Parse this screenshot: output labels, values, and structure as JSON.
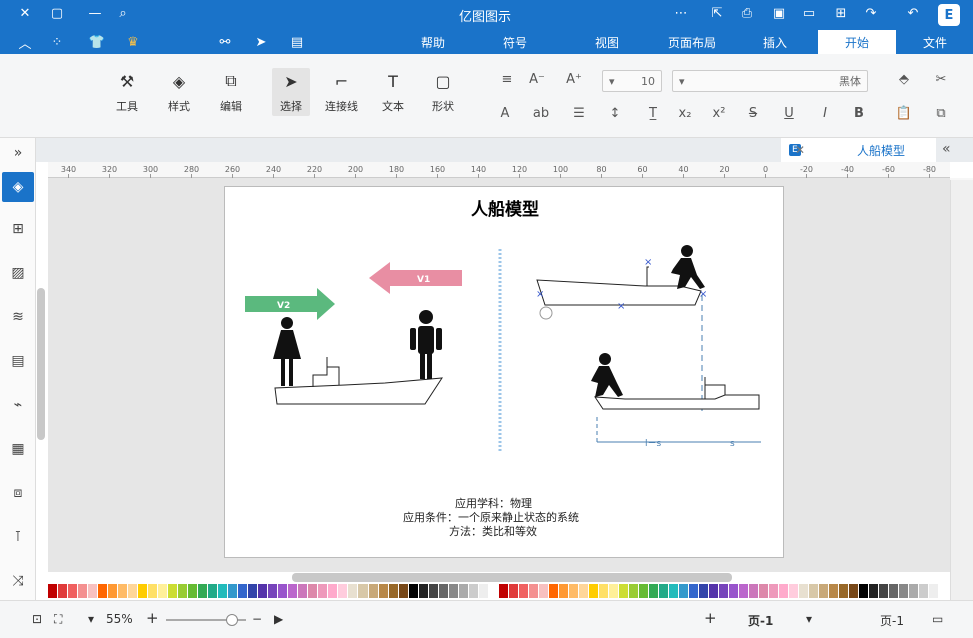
{
  "window": {
    "title": "亿图图示"
  },
  "tabs": [
    {
      "label": "文件"
    },
    {
      "label": "开始"
    },
    {
      "label": "插入"
    },
    {
      "label": "页面布局"
    },
    {
      "label": "视图"
    },
    {
      "label": "符号"
    },
    {
      "label": "帮助"
    }
  ],
  "ribbon": {
    "tools": {
      "shape": "形状",
      "text": "文本",
      "connector": "连接线",
      "select": "选择",
      "edit": "编辑",
      "style": "样式",
      "tool": "工具"
    },
    "font_name_placeholder": "黑体",
    "font_size": "10"
  },
  "doc_tab": {
    "label": "人船模型"
  },
  "ruler": {
    "ticks": [
      "-80",
      "-60",
      "-40",
      "-20",
      "0",
      "20",
      "40",
      "60",
      "80",
      "100",
      "120",
      "140",
      "160",
      "180",
      "200",
      "220",
      "240",
      "260",
      "280",
      "300",
      "320",
      "340"
    ]
  },
  "diagram": {
    "title": "人船模型",
    "arrow_v1": "V1",
    "arrow_v2": "V2",
    "notes": [
      "应用学科：物理",
      "应用条件：一个原来静止状态的系统",
      "方法：类比和等效"
    ],
    "dimension_labels": [
      "s",
      "l－s"
    ]
  },
  "status": {
    "page_select": "页-1",
    "page_tab": "页-1",
    "zoom": "55%"
  },
  "colors": {
    "accent": "#1a73c9",
    "arrow_green": "#5bb97e",
    "arrow_pink": "#e88ea3"
  }
}
